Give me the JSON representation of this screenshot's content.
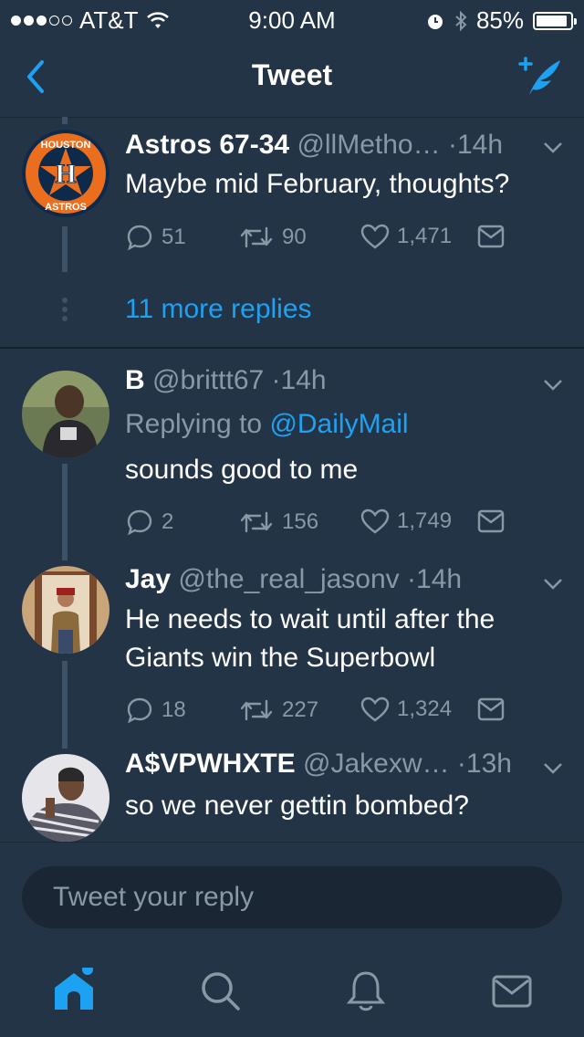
{
  "status_bar": {
    "carrier": "AT&T",
    "time": "9:00 AM",
    "battery": "85%"
  },
  "nav": {
    "title": "Tweet"
  },
  "tweets": [
    {
      "name": "Astros 67-34",
      "handle": "@llMetho…",
      "time": "14h",
      "text": "Maybe mid February, thoughts?",
      "avatar_text": {
        "top": "HOUSTON",
        "letter": "H",
        "bottom": "ASTROS"
      },
      "replies": "51",
      "retweets": "90",
      "likes": "1,471"
    },
    {
      "name": "B",
      "handle": "@brittt67",
      "time": "14h",
      "replying_prefix": "Replying to",
      "replying_to": "@DailyMail",
      "text": "sounds good to me",
      "replies": "2",
      "retweets": "156",
      "likes": "1,749"
    },
    {
      "name": "Jay",
      "handle": "@the_real_jasonv",
      "time": "14h",
      "text": "He needs to wait until after the Giants win the Superbowl",
      "replies": "18",
      "retweets": "227",
      "likes": "1,324"
    },
    {
      "name": "A$VPWHXTE",
      "handle": "@Jakexw…",
      "time": "13h",
      "text": "so we never gettin bombed?"
    }
  ],
  "more_replies": "11 more replies",
  "reply_placeholder": "Tweet your reply",
  "tabs": [
    "home-icon",
    "search-icon",
    "notifications-icon",
    "messages-icon"
  ],
  "colors": {
    "background": "#243447",
    "accent": "#1da1f2",
    "muted": "#8899a6"
  }
}
